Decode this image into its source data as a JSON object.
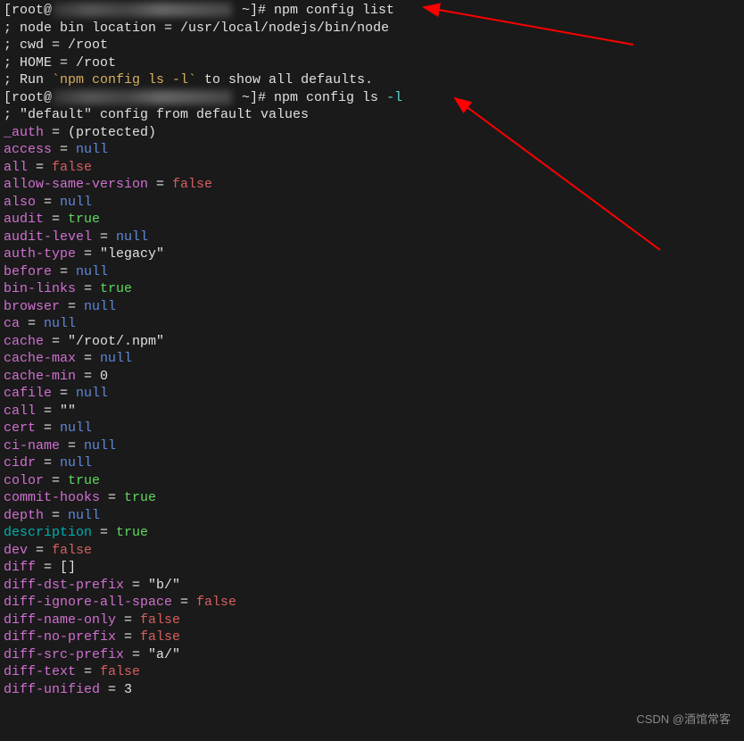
{
  "prompt1_prefix": "[root@",
  "prompt1_suffix": " ~]# ",
  "command1": "npm config list",
  "header_lines": {
    "nodebin": "; node bin location = /usr/local/nodejs/bin/node",
    "cwd": "; cwd = /root",
    "home": "; HOME = /root",
    "run_prefix": "; Run ",
    "run_cmd": "`npm config ls -l`",
    "run_suffix": " to show all defaults."
  },
  "prompt2_prefix": "[root@",
  "prompt2_suffix": " ~]# ",
  "command2_part1": "npm config ls ",
  "command2_flag": "-l",
  "comment_default": "; \"default\" config from default values",
  "blank": "",
  "config": {
    "auth": {
      "key": "_auth",
      "eq": " = ",
      "val": "(protected)"
    },
    "access": {
      "key": "access",
      "eq": " = ",
      "val": "null"
    },
    "all": {
      "key": "all",
      "eq": " = ",
      "val": "false"
    },
    "allow_same_version": {
      "key": "allow-same-version",
      "eq": " = ",
      "val": "false"
    },
    "also": {
      "key": "also",
      "eq": " = ",
      "val": "null"
    },
    "audit": {
      "key": "audit",
      "eq": " = ",
      "val": "true"
    },
    "audit_level": {
      "key": "audit-level",
      "eq": " = ",
      "val": "null"
    },
    "auth_type": {
      "key": "auth-type",
      "eq": " = ",
      "val": "\"legacy\""
    },
    "before": {
      "key": "before",
      "eq": " = ",
      "val": "null"
    },
    "bin_links": {
      "key": "bin-links",
      "eq": " = ",
      "val": "true"
    },
    "browser": {
      "key": "browser",
      "eq": " = ",
      "val": "null"
    },
    "ca": {
      "key": "ca",
      "eq": " = ",
      "val": "null"
    },
    "cache": {
      "key": "cache",
      "eq": " = ",
      "val": "\"/root/.npm\""
    },
    "cache_max": {
      "key": "cache-max",
      "eq": " = ",
      "val": "null"
    },
    "cache_min": {
      "key": "cache-min",
      "eq": " = ",
      "val": "0"
    },
    "cafile": {
      "key": "cafile",
      "eq": " = ",
      "val": "null"
    },
    "call": {
      "key": "call",
      "eq": " = ",
      "val": "\"\""
    },
    "cert": {
      "key": "cert",
      "eq": " = ",
      "val": "null"
    },
    "ci_name": {
      "key": "ci-name",
      "eq": " = ",
      "val": "null"
    },
    "cidr": {
      "key": "cidr",
      "eq": " = ",
      "val": "null"
    },
    "color": {
      "key": "color",
      "eq": " = ",
      "val": "true"
    },
    "commit_hooks": {
      "key": "commit-hooks",
      "eq": " = ",
      "val": "true"
    },
    "depth": {
      "key": "depth",
      "eq": " = ",
      "val": "null"
    },
    "description": {
      "key": "description",
      "eq": " = ",
      "val": "true"
    },
    "dev": {
      "key": "dev",
      "eq": " = ",
      "val": "false"
    },
    "diff": {
      "key": "diff",
      "eq": " = ",
      "val": "[]"
    },
    "diff_dst_prefix": {
      "key": "diff-dst-prefix",
      "eq": " = ",
      "val": "\"b/\""
    },
    "diff_ignore_all_space": {
      "key": "diff-ignore-all-space",
      "eq": " = ",
      "val": "false"
    },
    "diff_name_only": {
      "key": "diff-name-only",
      "eq": " = ",
      "val": "false"
    },
    "diff_no_prefix": {
      "key": "diff-no-prefix",
      "eq": " = ",
      "val": "false"
    },
    "diff_src_prefix": {
      "key": "diff-src-prefix",
      "eq": " = ",
      "val": "\"a/\""
    },
    "diff_text": {
      "key": "diff-text",
      "eq": " = ",
      "val": "false"
    },
    "diff_unified": {
      "key": "diff-unified",
      "eq": " = ",
      "val": "3"
    }
  },
  "watermark": "CSDN @酒馆常客"
}
